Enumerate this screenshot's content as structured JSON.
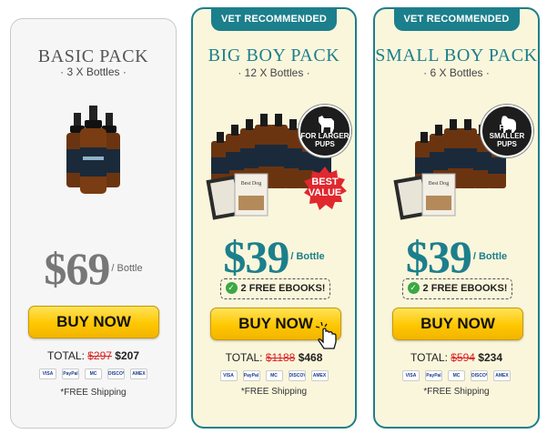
{
  "cards": {
    "basic": {
      "title": "BASIC PACK",
      "bottles": "· 3 X Bottles ·",
      "price": "$69",
      "per_bottle": "/ Bottle",
      "buy_label": "BUY NOW",
      "total_label": "TOTAL:",
      "total_old": "$297",
      "total_new": "$207",
      "shipping": "*FREE Shipping"
    },
    "big": {
      "ribbon": "VET RECOMMENDED",
      "title": "BIG BOY PACK",
      "bottles": "· 12 X Bottles ·",
      "badge": "FOR LARGER PUPS",
      "best_value": "BEST VALUE",
      "price": "$39",
      "per_bottle": "/ Bottle",
      "ebooks": "2 FREE EBOOKS!",
      "buy_label": "BUY NOW",
      "total_label": "TOTAL:",
      "total_old": "$1188",
      "total_new": "$468",
      "shipping": "*FREE Shipping"
    },
    "small": {
      "ribbon": "VET RECOMMENDED",
      "title": "SMALL BOY PACK",
      "bottles": "· 6 X Bottles ·",
      "badge": "FOR SMALLER PUPS",
      "price": "$39",
      "per_bottle": "/ Bottle",
      "ebooks": "2 FREE EBOOKS!",
      "buy_label": "BUY NOW",
      "total_label": "TOTAL:",
      "total_old": "$594",
      "total_new": "$234",
      "shipping": "*FREE Shipping"
    }
  },
  "payment_methods": [
    "VISA",
    "PayPal",
    "MC",
    "DISCOVER",
    "AMEX"
  ],
  "colors": {
    "accent": "#1c7f8c",
    "button": "#ffc700",
    "strike": "#d92020",
    "highlight_bg": "#faf6dc"
  }
}
